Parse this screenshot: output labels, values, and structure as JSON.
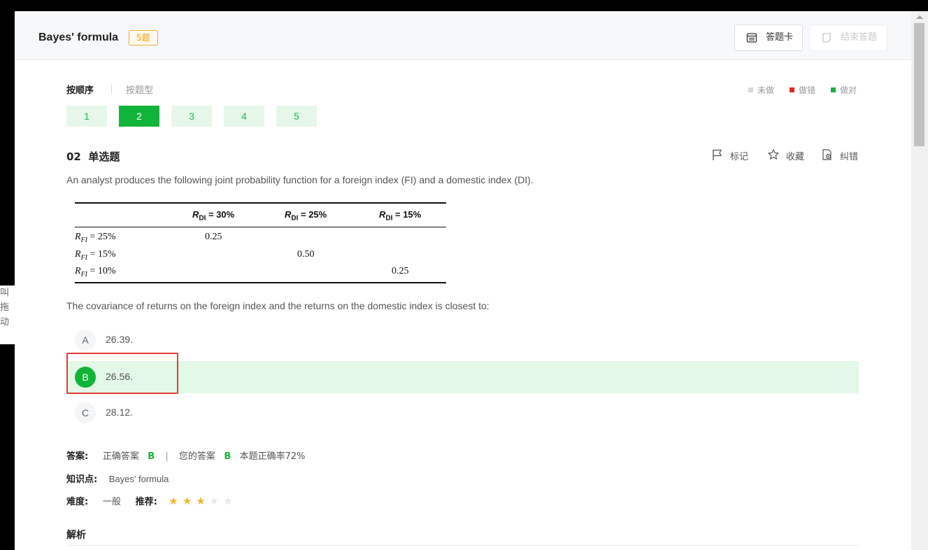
{
  "header": {
    "title": "Bayes' formula",
    "count_badge": "5题",
    "answer_card_label": "答题卡",
    "end_label": "结束答题"
  },
  "drag_tab": {
    "chars": [
      "叫",
      "拖",
      "动"
    ]
  },
  "tabs": {
    "sequence": "按顺序",
    "by_type": "按题型"
  },
  "legend": {
    "undone": "未做",
    "wrong": "做错",
    "correct": "做对",
    "colors": {
      "undone": "#d9d9d9",
      "wrong": "#e0291c",
      "correct": "#11b43a"
    }
  },
  "question_numbers": [
    {
      "label": "1",
      "active": false
    },
    {
      "label": "2",
      "active": true
    },
    {
      "label": "3",
      "active": false
    },
    {
      "label": "4",
      "active": false
    },
    {
      "label": "5",
      "active": false
    }
  ],
  "question": {
    "number": "02",
    "type": "单选题",
    "actions": {
      "mark": "标记",
      "favorite": "收藏",
      "report": "纠错"
    },
    "text": "An analyst produces the following joint probability function for a foreign index (FI) and a domestic index (DI).",
    "table": {
      "columns": [
        {
          "var": "R",
          "sub": "DI",
          "val": " = 30%"
        },
        {
          "var": "R",
          "sub": "DI",
          "val": " = 25%"
        },
        {
          "var": "R",
          "sub": "DI",
          "val": " = 15%"
        }
      ],
      "rows": [
        {
          "label_var": "R",
          "label_sub": "FI",
          "label_val": " = 25%",
          "cells": [
            "0.25",
            "",
            ""
          ]
        },
        {
          "label_var": "R",
          "label_sub": "FI",
          "label_val": " = 15%",
          "cells": [
            "",
            "0.50",
            ""
          ]
        },
        {
          "label_var": "R",
          "label_sub": "FI",
          "label_val": " = 10%",
          "cells": [
            "",
            "",
            "0.25"
          ]
        }
      ]
    },
    "prompt": "The covariance of returns on the foreign index and the returns on the domestic index is closest to:",
    "options": [
      {
        "letter": "A",
        "text": "26.39.",
        "selected": false
      },
      {
        "letter": "B",
        "text": "26.56.",
        "selected": true
      },
      {
        "letter": "C",
        "text": "28.12.",
        "selected": false
      }
    ]
  },
  "answer": {
    "label": "答案:",
    "correct_label": "正确答案",
    "correct_value": "B",
    "separator": "|",
    "yours_label": "您的答案",
    "yours_value": "B",
    "accuracy": "本题正确率72%"
  },
  "knowledge": {
    "label": "知识点:",
    "value": "Bayes' formula"
  },
  "difficulty": {
    "label": "难度:",
    "value": "一般",
    "recommend_label": "推荐:",
    "stars_filled": 3,
    "stars_total": 5
  },
  "analysis": {
    "label": "解析"
  }
}
